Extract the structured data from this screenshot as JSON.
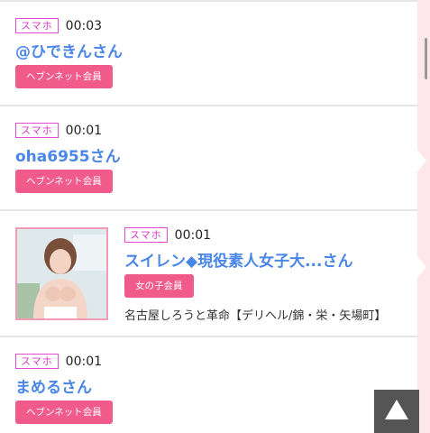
{
  "entries": [
    {
      "device": "スマホ",
      "time": "00:03",
      "name": "@ひできんさん",
      "member_type": "ヘブンネット会員"
    },
    {
      "device": "スマホ",
      "time": "00:01",
      "name": "oha6955さん",
      "member_type": "ヘブンネット会員"
    },
    {
      "device": "スマホ",
      "time": "00:01",
      "name": "スイレン◆現役素人女子大...さん",
      "member_type": "女の子会員",
      "shop": "名古屋しろうと革命【デリヘル/錦・栄・矢場町】"
    },
    {
      "device": "スマホ",
      "time": "00:01",
      "name": "まめるさん",
      "member_type": "ヘブンネット会員"
    }
  ],
  "colors": {
    "badge_border": "#e44ad2",
    "name_blue": "#4a86e8",
    "member_button": "#f05b8c",
    "photo_border": "#f29bb6",
    "back_to_top": "#555555"
  },
  "icons": {
    "back_to_top": "triangle-up-icon"
  }
}
